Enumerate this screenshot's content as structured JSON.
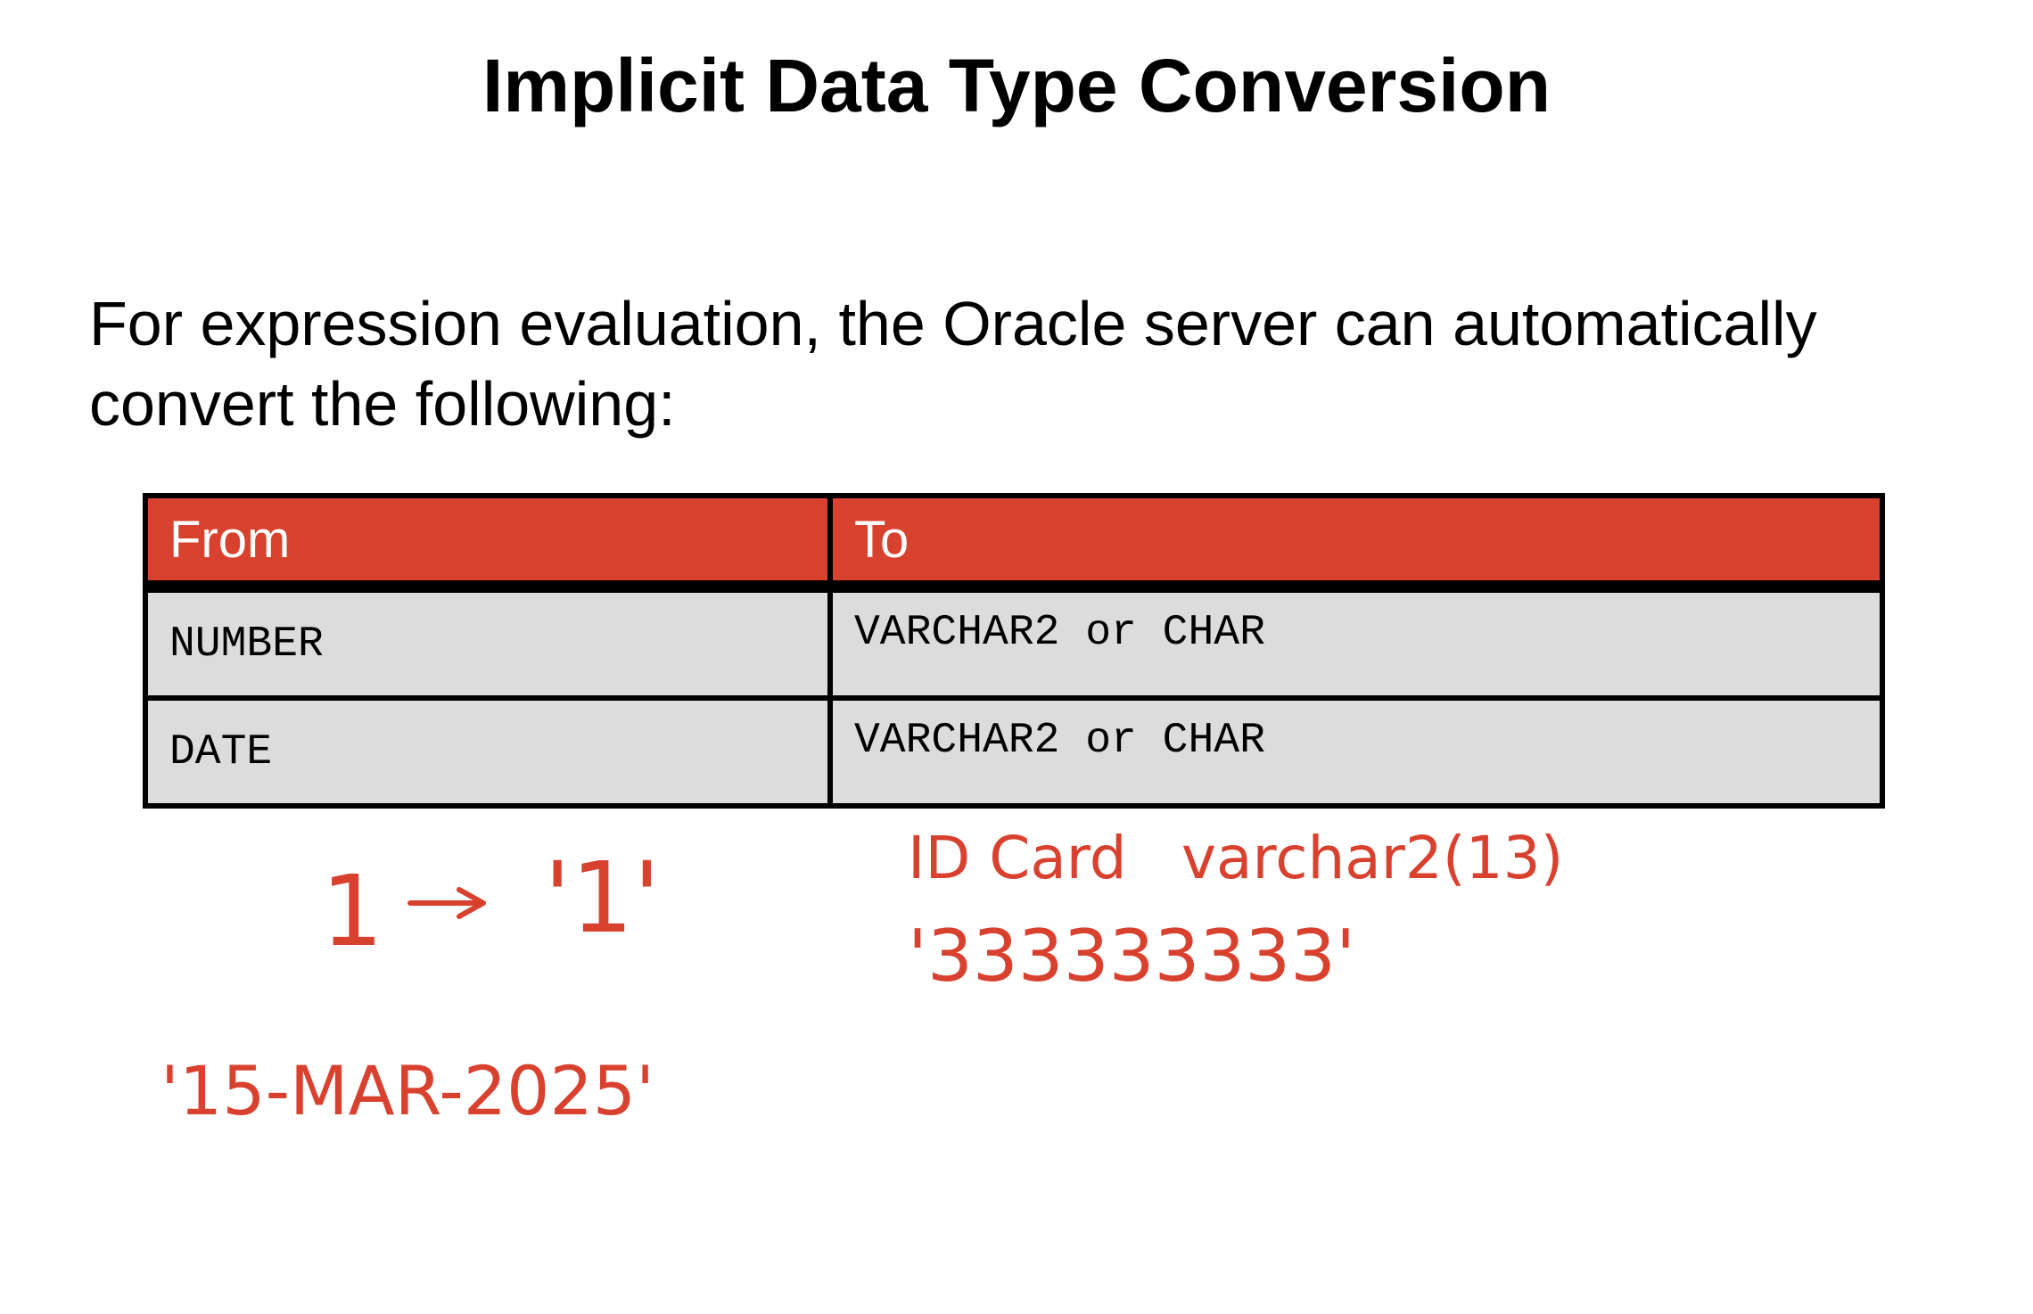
{
  "title": "Implicit Data Type Conversion",
  "intro": {
    "line1": "For expression evaluation, the Oracle server can automatically",
    "line2": "convert the following:"
  },
  "table": {
    "headers": [
      "From",
      "To"
    ],
    "rows": [
      {
        "from": "NUMBER",
        "to": "VARCHAR2 or CHAR"
      },
      {
        "from": "DATE",
        "to": "VARCHAR2 or CHAR"
      }
    ]
  },
  "annotations": {
    "number_source": "1",
    "number_target": "'1'",
    "date_literal": "'15-MAR-2025'",
    "id_label": "ID Card",
    "id_type": "varchar2(13)",
    "id_value": "'333333333'"
  },
  "colors": {
    "header_red": "#d9412f",
    "cell_gray": "#dcdcdc",
    "ink_red": "#d9412f"
  }
}
